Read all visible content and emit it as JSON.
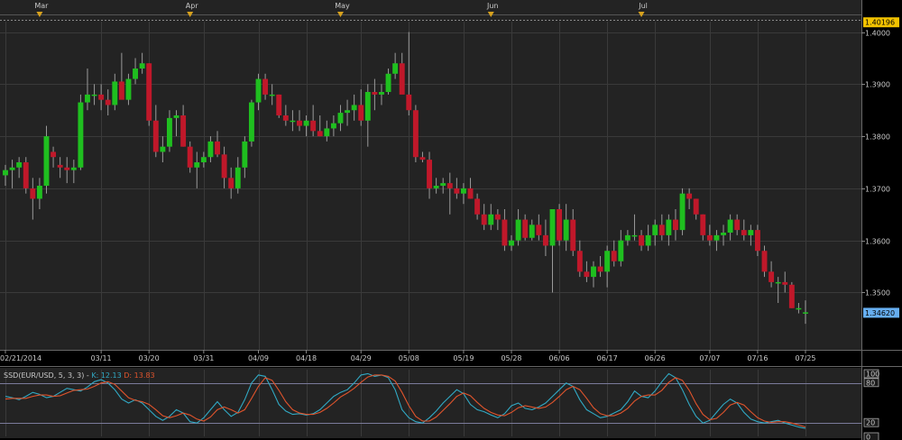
{
  "colors": {
    "background": "#232323",
    "grid": "#3a3a3a",
    "up": "#1fbf1f",
    "down": "#c0182a",
    "wick": "#9a9a9a",
    "k_line": "#31a9c4",
    "d_line": "#e0542c",
    "marker": "#d7a11d",
    "last_price_box": "#66aef0",
    "top_price_box": "#f2c200"
  },
  "chart_data": [
    {
      "type": "candlestick",
      "name_label": "EUR/USD",
      "ylim": [
        1.339,
        1.402
      ],
      "yticks": [
        "1.4000",
        "1.3900",
        "1.3800",
        "1.3700",
        "1.3600",
        "1.3500"
      ],
      "ytick_values": [
        1.4,
        1.39,
        1.38,
        1.37,
        1.36,
        1.35
      ],
      "xtick_labels": [
        "02/21/2014",
        "03/11",
        "03/20",
        "03/31",
        "04/09",
        "04/18",
        "04/29",
        "05/08",
        "05/19",
        "05/28",
        "06/06",
        "06/17",
        "06/26",
        "07/07",
        "07/16",
        "07/25"
      ],
      "xtick_index": [
        0,
        14,
        21,
        29,
        37,
        44,
        52,
        59,
        67,
        74,
        81,
        88,
        95,
        103,
        110,
        117
      ],
      "month_markers": [
        {
          "label": "Mar",
          "index": 5
        },
        {
          "label": "Apr",
          "index": 27
        },
        {
          "label": "May",
          "index": 49
        },
        {
          "label": "Jun",
          "index": 71
        },
        {
          "label": "Jul",
          "index": 93
        }
      ],
      "price_labels": {
        "top": "1.40196",
        "last": "1.34620"
      },
      "top_value": 1.40196,
      "last_value": 1.3462,
      "ohlc": [
        [
          1.3725,
          1.3745,
          1.3705,
          1.3735
        ],
        [
          1.3735,
          1.3755,
          1.37,
          1.374
        ],
        [
          1.374,
          1.376,
          1.372,
          1.375
        ],
        [
          1.375,
          1.376,
          1.369,
          1.37
        ],
        [
          1.37,
          1.372,
          1.364,
          1.368
        ],
        [
          1.368,
          1.372,
          1.366,
          1.3705
        ],
        [
          1.3705,
          1.382,
          1.369,
          1.38
        ],
        [
          1.377,
          1.378,
          1.374,
          1.376
        ],
        [
          1.3745,
          1.376,
          1.372,
          1.374
        ],
        [
          1.374,
          1.376,
          1.371,
          1.3735
        ],
        [
          1.3735,
          1.3755,
          1.371,
          1.374
        ],
        [
          1.374,
          1.388,
          1.3735,
          1.3865
        ],
        [
          1.3865,
          1.393,
          1.385,
          1.388
        ],
        [
          1.388,
          1.39,
          1.386,
          1.388
        ],
        [
          1.388,
          1.39,
          1.385,
          1.387
        ],
        [
          1.387,
          1.389,
          1.384,
          1.386
        ],
        [
          1.386,
          1.392,
          1.385,
          1.3905
        ],
        [
          1.3905,
          1.396,
          1.389,
          1.387
        ],
        [
          1.387,
          1.392,
          1.386,
          1.391
        ],
        [
          1.391,
          1.395,
          1.39,
          1.393
        ],
        [
          1.393,
          1.396,
          1.392,
          1.394
        ],
        [
          1.394,
          1.394,
          1.382,
          1.383
        ],
        [
          1.383,
          1.386,
          1.376,
          1.377
        ],
        [
          1.377,
          1.38,
          1.375,
          1.378
        ],
        [
          1.378,
          1.385,
          1.377,
          1.3835
        ],
        [
          1.3835,
          1.385,
          1.38,
          1.384
        ],
        [
          1.384,
          1.386,
          1.378,
          1.378
        ],
        [
          1.378,
          1.379,
          1.373,
          1.374
        ],
        [
          1.374,
          1.377,
          1.37,
          1.375
        ],
        [
          1.375,
          1.377,
          1.374,
          1.376
        ],
        [
          1.376,
          1.38,
          1.375,
          1.379
        ],
        [
          1.379,
          1.381,
          1.376,
          1.3765
        ],
        [
          1.3765,
          1.378,
          1.37,
          1.372
        ],
        [
          1.372,
          1.374,
          1.368,
          1.37
        ],
        [
          1.37,
          1.376,
          1.369,
          1.374
        ],
        [
          1.374,
          1.38,
          1.372,
          1.379
        ],
        [
          1.379,
          1.387,
          1.378,
          1.3865
        ],
        [
          1.3865,
          1.392,
          1.385,
          1.391
        ],
        [
          1.391,
          1.392,
          1.387,
          1.388
        ],
        [
          1.388,
          1.39,
          1.386,
          1.388
        ],
        [
          1.388,
          1.388,
          1.3835,
          1.384
        ],
        [
          1.384,
          1.386,
          1.382,
          1.383
        ],
        [
          1.383,
          1.385,
          1.381,
          1.383
        ],
        [
          1.383,
          1.385,
          1.381,
          1.382
        ],
        [
          1.382,
          1.384,
          1.38,
          1.383
        ],
        [
          1.383,
          1.386,
          1.38,
          1.381
        ],
        [
          1.381,
          1.384,
          1.38,
          1.38
        ],
        [
          1.38,
          1.383,
          1.379,
          1.3815
        ],
        [
          1.3815,
          1.384,
          1.38,
          1.3825
        ],
        [
          1.3825,
          1.386,
          1.381,
          1.3845
        ],
        [
          1.3845,
          1.387,
          1.382,
          1.385
        ],
        [
          1.385,
          1.388,
          1.383,
          1.386
        ],
        [
          1.386,
          1.389,
          1.382,
          1.383
        ],
        [
          1.383,
          1.39,
          1.378,
          1.3885
        ],
        [
          1.3885,
          1.391,
          1.385,
          1.388
        ],
        [
          1.388,
          1.39,
          1.386,
          1.3885
        ],
        [
          1.3885,
          1.393,
          1.388,
          1.392
        ],
        [
          1.392,
          1.396,
          1.391,
          1.394
        ],
        [
          1.394,
          1.396,
          1.391,
          1.388
        ],
        [
          1.388,
          1.4,
          1.384,
          1.385
        ],
        [
          1.385,
          1.386,
          1.375,
          1.376
        ],
        [
          1.376,
          1.377,
          1.375,
          1.3755
        ],
        [
          1.3755,
          1.377,
          1.368,
          1.37
        ],
        [
          1.37,
          1.372,
          1.369,
          1.3705
        ],
        [
          1.3705,
          1.372,
          1.369,
          1.371
        ],
        [
          1.371,
          1.373,
          1.365,
          1.37
        ],
        [
          1.37,
          1.372,
          1.368,
          1.369
        ],
        [
          1.369,
          1.371,
          1.367,
          1.37
        ],
        [
          1.37,
          1.372,
          1.368,
          1.368
        ],
        [
          1.368,
          1.369,
          1.364,
          1.365
        ],
        [
          1.365,
          1.367,
          1.362,
          1.363
        ],
        [
          1.363,
          1.367,
          1.362,
          1.365
        ],
        [
          1.365,
          1.366,
          1.362,
          1.364
        ],
        [
          1.364,
          1.366,
          1.358,
          1.359
        ],
        [
          1.359,
          1.361,
          1.358,
          1.36
        ],
        [
          1.36,
          1.366,
          1.359,
          1.364
        ],
        [
          1.364,
          1.365,
          1.36,
          1.3605
        ],
        [
          1.3605,
          1.364,
          1.36,
          1.363
        ],
        [
          1.363,
          1.365,
          1.36,
          1.361
        ],
        [
          1.361,
          1.364,
          1.357,
          1.359
        ],
        [
          1.359,
          1.364,
          1.35,
          1.366
        ],
        [
          1.366,
          1.367,
          1.359,
          1.36
        ],
        [
          1.36,
          1.367,
          1.358,
          1.364
        ],
        [
          1.364,
          1.366,
          1.357,
          1.358
        ],
        [
          1.358,
          1.36,
          1.353,
          1.354
        ],
        [
          1.354,
          1.356,
          1.352,
          1.353
        ],
        [
          1.353,
          1.356,
          1.351,
          1.355
        ],
        [
          1.355,
          1.357,
          1.353,
          1.354
        ],
        [
          1.354,
          1.359,
          1.351,
          1.358
        ],
        [
          1.358,
          1.36,
          1.355,
          1.356
        ],
        [
          1.356,
          1.362,
          1.355,
          1.36
        ],
        [
          1.36,
          1.362,
          1.359,
          1.361
        ],
        [
          1.361,
          1.365,
          1.36,
          1.361
        ],
        [
          1.361,
          1.362,
          1.358,
          1.359
        ],
        [
          1.359,
          1.363,
          1.358,
          1.361
        ],
        [
          1.361,
          1.364,
          1.359,
          1.363
        ],
        [
          1.363,
          1.365,
          1.36,
          1.361
        ],
        [
          1.361,
          1.365,
          1.359,
          1.364
        ],
        [
          1.364,
          1.366,
          1.36,
          1.362
        ],
        [
          1.362,
          1.37,
          1.361,
          1.369
        ],
        [
          1.369,
          1.37,
          1.366,
          1.368
        ],
        [
          1.368,
          1.368,
          1.364,
          1.365
        ],
        [
          1.365,
          1.365,
          1.36,
          1.361
        ],
        [
          1.361,
          1.363,
          1.359,
          1.36
        ],
        [
          1.36,
          1.362,
          1.358,
          1.361
        ],
        [
          1.361,
          1.363,
          1.359,
          1.3615
        ],
        [
          1.3615,
          1.365,
          1.36,
          1.364
        ],
        [
          1.364,
          1.365,
          1.361,
          1.362
        ],
        [
          1.362,
          1.364,
          1.36,
          1.361
        ],
        [
          1.361,
          1.363,
          1.359,
          1.362
        ],
        [
          1.362,
          1.363,
          1.357,
          1.358
        ],
        [
          1.358,
          1.359,
          1.353,
          1.354
        ],
        [
          1.354,
          1.356,
          1.351,
          1.352
        ],
        [
          1.352,
          1.353,
          1.348,
          1.352
        ],
        [
          1.352,
          1.354,
          1.35,
          1.3515
        ],
        [
          1.3515,
          1.352,
          1.347,
          1.347
        ],
        [
          1.347,
          1.348,
          1.346,
          1.347
        ],
        [
          1.346,
          1.3485,
          1.344,
          1.3462
        ]
      ]
    },
    {
      "type": "line",
      "title": "SSD(EUR/USD, 5, 3, 3) -",
      "k_label": "K: 12.13",
      "d_label": "D: 13.83",
      "ylim": [
        0,
        100
      ],
      "yticks": [
        "100",
        "80",
        "20",
        "0"
      ],
      "ytick_values": [
        100,
        80,
        20,
        0
      ],
      "series": [
        {
          "name": "K",
          "values": [
            60,
            58,
            55,
            60,
            66,
            63,
            58,
            60,
            66,
            72,
            70,
            68,
            74,
            82,
            85,
            80,
            70,
            56,
            50,
            55,
            50,
            40,
            30,
            24,
            30,
            40,
            35,
            22,
            20,
            28,
            40,
            52,
            40,
            30,
            36,
            55,
            80,
            92,
            90,
            70,
            48,
            38,
            33,
            34,
            32,
            34,
            40,
            50,
            60,
            66,
            70,
            80,
            92,
            94,
            90,
            92,
            88,
            70,
            40,
            28,
            22,
            20,
            28,
            38,
            50,
            60,
            70,
            64,
            48,
            40,
            37,
            32,
            28,
            34,
            46,
            50,
            42,
            40,
            44,
            50,
            60,
            70,
            80,
            75,
            55,
            40,
            34,
            28,
            30,
            35,
            40,
            52,
            68,
            60,
            58,
            68,
            82,
            94,
            88,
            70,
            48,
            30,
            20,
            24,
            36,
            48,
            56,
            50,
            36,
            26,
            22,
            20,
            22,
            24,
            20,
            17,
            14,
            12
          ]
        },
        {
          "name": "D",
          "values": [
            56,
            57,
            57,
            57,
            60,
            62,
            62,
            60,
            61,
            65,
            69,
            70,
            71,
            75,
            80,
            82,
            78,
            68,
            58,
            54,
            52,
            48,
            40,
            31,
            28,
            31,
            35,
            32,
            26,
            23,
            29,
            40,
            44,
            40,
            35,
            40,
            57,
            75,
            88,
            84,
            69,
            52,
            40,
            35,
            33,
            33,
            36,
            42,
            50,
            59,
            65,
            72,
            81,
            89,
            92,
            92,
            90,
            83,
            66,
            46,
            30,
            23,
            23,
            29,
            39,
            49,
            60,
            65,
            61,
            51,
            42,
            36,
            32,
            31,
            36,
            43,
            46,
            44,
            42,
            44,
            51,
            60,
            70,
            75,
            70,
            57,
            43,
            34,
            31,
            31,
            35,
            42,
            53,
            60,
            62,
            62,
            69,
            81,
            88,
            84,
            69,
            49,
            33,
            25,
            27,
            36,
            47,
            51,
            47,
            37,
            28,
            23,
            21,
            22,
            22,
            20,
            17,
            14
          ]
        }
      ]
    }
  ]
}
